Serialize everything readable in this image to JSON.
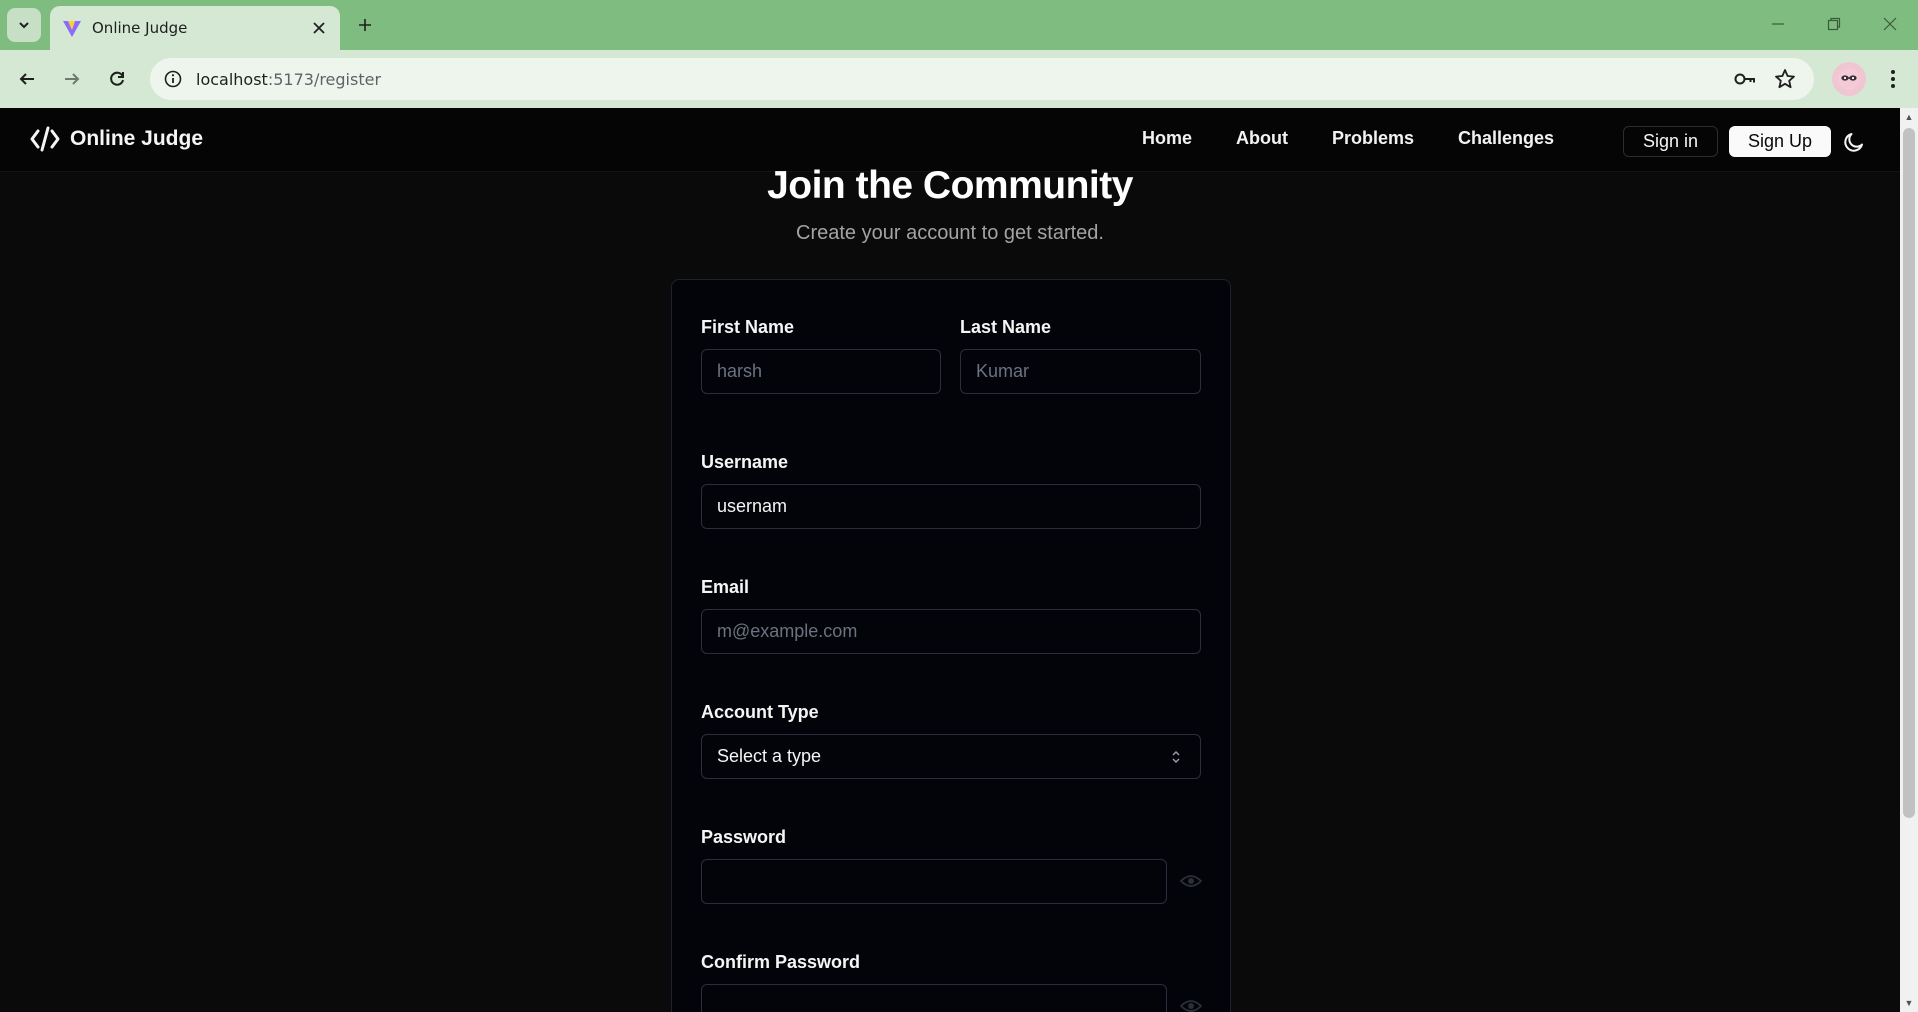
{
  "browser": {
    "tab_title": "Online Judge",
    "url_host": "localhost",
    "url_path": ":5173/register"
  },
  "site": {
    "brand": "Online Judge",
    "nav": [
      "Home",
      "About",
      "Problems",
      "Challenges"
    ],
    "sign_in": "Sign in",
    "sign_up": "Sign Up"
  },
  "form": {
    "title": "Join the Community",
    "subtitle": "Create your account to get started.",
    "first_name": {
      "label": "First Name",
      "placeholder": "harsh",
      "value": ""
    },
    "last_name": {
      "label": "Last Name",
      "placeholder": "Kumar",
      "value": ""
    },
    "username": {
      "label": "Username",
      "placeholder": "",
      "value": "usernam"
    },
    "email": {
      "label": "Email",
      "placeholder": "m@example.com",
      "value": ""
    },
    "account_type": {
      "label": "Account Type",
      "selected": "Select a type"
    },
    "password": {
      "label": "Password",
      "value": ""
    },
    "confirm_password": {
      "label": "Confirm Password",
      "value": ""
    }
  },
  "colors": {
    "browser_frame": "#7ebd7f",
    "page_bg": "#0a0a0a",
    "card_bg": "#020409"
  }
}
